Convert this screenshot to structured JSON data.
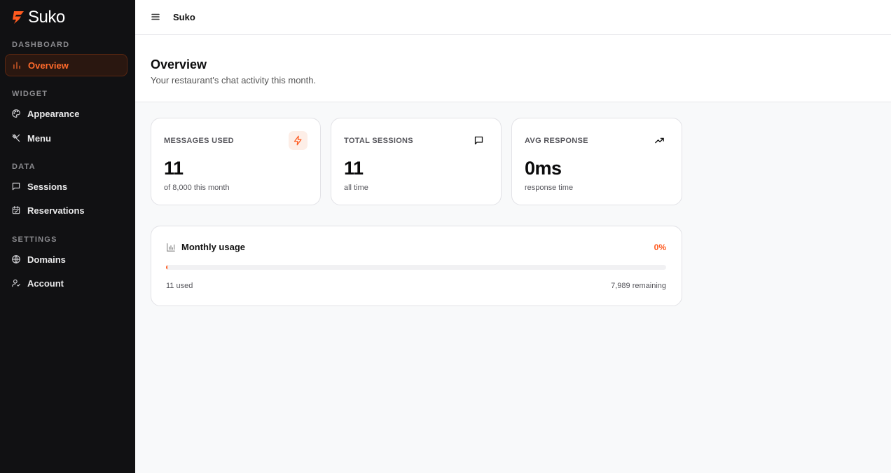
{
  "brand": {
    "name": "Suko",
    "accent": "#ff5a1f"
  },
  "sidebar": {
    "sections": [
      {
        "label": "DASHBOARD",
        "items": [
          {
            "label": "Overview",
            "icon": "bar-chart-icon",
            "active": true
          }
        ]
      },
      {
        "label": "WIDGET",
        "items": [
          {
            "label": "Appearance",
            "icon": "palette-icon"
          },
          {
            "label": "Menu",
            "icon": "utensils-icon"
          }
        ]
      },
      {
        "label": "DATA",
        "items": [
          {
            "label": "Sessions",
            "icon": "message-square-icon"
          },
          {
            "label": "Reservations",
            "icon": "calendar-icon"
          }
        ]
      },
      {
        "label": "SETTINGS",
        "items": [
          {
            "label": "Domains",
            "icon": "globe-icon"
          },
          {
            "label": "Account",
            "icon": "user-icon"
          }
        ]
      }
    ]
  },
  "header": {
    "title": "Suko"
  },
  "page": {
    "title": "Overview",
    "subtitle": "Your restaurant's chat activity this month."
  },
  "stats": [
    {
      "label": "MESSAGES USED",
      "value": "11",
      "caption": "of 8,000 this month",
      "icon": "zap-icon"
    },
    {
      "label": "TOTAL SESSIONS",
      "value": "11",
      "caption": "all time",
      "icon": "message-square-icon"
    },
    {
      "label": "AVG RESPONSE",
      "value": "0ms",
      "caption": "response time",
      "icon": "trending-up-icon"
    }
  ],
  "usage": {
    "title": "Monthly usage",
    "percent_label": "0%",
    "progress": 0.001375,
    "used_label": "11 used",
    "remaining_label": "7,989 remaining"
  }
}
